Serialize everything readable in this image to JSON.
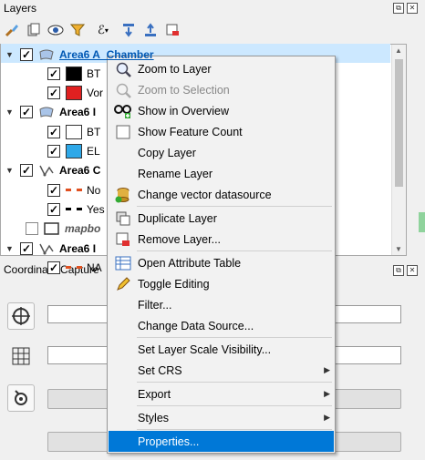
{
  "layers_panel": {
    "title": "Layers",
    "toolbar_icons": [
      "paintbrush-icon",
      "add-group-icon",
      "eye-icon",
      "filter-icon",
      "expression-filter-icon",
      "expand-all-icon",
      "collapse-all-icon",
      "remove-layer-icon"
    ],
    "tree": [
      {
        "type": "layer",
        "name": "Area6 A_Chamber",
        "checked": true,
        "selected": true
      },
      {
        "type": "legend",
        "label": "BT",
        "color": "#000000",
        "checked": true
      },
      {
        "type": "legend",
        "label": "Vor",
        "color": "#e02020",
        "checked": true
      },
      {
        "type": "layer",
        "name": "Area6 I",
        "checked": true
      },
      {
        "type": "legend",
        "label": "BT",
        "color": "#ffffff",
        "checked": true
      },
      {
        "type": "legend",
        "label": "EL",
        "color": "#2ea8e8",
        "checked": true
      },
      {
        "type": "layer",
        "name": "Area6 C",
        "checked": true
      },
      {
        "type": "legend",
        "label": "No",
        "color": "#e05020",
        "checked": true
      },
      {
        "type": "legend",
        "label": "Yes",
        "color": "#000000",
        "checked": true
      },
      {
        "type": "layer",
        "name": "mapbo",
        "checked": false
      },
      {
        "type": "layer",
        "name": "Area6 I",
        "checked": true
      },
      {
        "type": "legend",
        "label": "NA",
        "color": "#e05020",
        "checked": true
      }
    ]
  },
  "coordinate_panel": {
    "title": "Coordinate Capture"
  },
  "context_menu": {
    "items": [
      {
        "label": "Zoom to Layer",
        "icon": "zoom-layer-icon",
        "ul": "Z"
      },
      {
        "label": "Zoom to Selection",
        "icon": "zoom-selection-icon",
        "disabled": true,
        "ul": "Z"
      },
      {
        "label": "Show in Overview",
        "icon": "overview-glasses-icon",
        "ul": "S"
      },
      {
        "label": "Show Feature Count",
        "icon": "checkbox-icon"
      },
      {
        "label": "Copy Layer"
      },
      {
        "label": "Rename Layer",
        "ul": "n"
      },
      {
        "label": "Change vector datasource",
        "icon": "datasource-icon",
        "sep_after": true
      },
      {
        "label": "Duplicate Layer",
        "icon": "duplicate-icon",
        "ul": "D"
      },
      {
        "label": "Remove Layer...",
        "icon": "remove-icon",
        "ul": "R",
        "sep_after": true
      },
      {
        "label": "Open Attribute Table",
        "icon": "attribute-table-icon",
        "ul": "O"
      },
      {
        "label": "Toggle Editing",
        "icon": "pencil-icon"
      },
      {
        "label": "Filter...",
        "ul": "F"
      },
      {
        "label": "Change Data Source...",
        "sep_after": true
      },
      {
        "label": "Set Layer Scale Visibility...",
        "ul": "S"
      },
      {
        "label": "Set CRS",
        "submenu": true,
        "sep_after": true
      },
      {
        "label": "Export",
        "submenu": true,
        "sep_after": true
      },
      {
        "label": "Styles",
        "submenu": true,
        "sep_after": true
      },
      {
        "label": "Properties...",
        "highlighted": true,
        "ul": "P"
      }
    ]
  },
  "colors": {
    "accent": "#0078d7",
    "selection": "#cce8ff"
  }
}
